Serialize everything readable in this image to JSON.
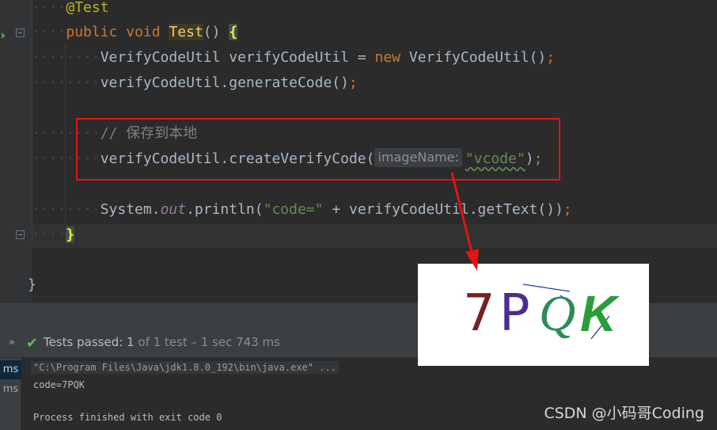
{
  "editor": {
    "lines": {
      "annotation": "@Test",
      "kw_public": "public",
      "kw_void": "void",
      "method_name": "Test",
      "parens_open": "() ",
      "brace_open": "{",
      "l1_type": "VerifyCodeUtil",
      "l1_var": " verifyCodeUtil = ",
      "kw_new": "new",
      "l1_ctor": " VerifyCodeUtil()",
      "semi": ";",
      "l2_code": "verifyCodeUtil.generateCode()",
      "comment": "// 保存到本地",
      "l4_call": "verifyCodeUtil.createVerifyCode(",
      "l4_hint": "imageName:",
      "l4_arg": "\"vcode\"",
      "l4_close": ")",
      "l5_sys": "System.",
      "l5_out": "out",
      "l5_print": ".println(",
      "l5_str": "\"code=\"",
      "l5_rest": " + verifyCodeUtil.getText())",
      "brace_close_method": "}",
      "brace_close_class": "}"
    }
  },
  "run_panel": {
    "status_prefix": "Tests passed:",
    "status_count": "1",
    "status_suffix": "of 1 test – 1 sec 743 ms",
    "left_items": [
      "ms",
      "ms"
    ],
    "console": {
      "cmd": "\"C:\\Program Files\\Java\\jdk1.8.0_192\\bin\\java.exe\" ...",
      "output": "code=7PQK",
      "exit": "Process finished with exit code 0"
    }
  },
  "captcha": {
    "chars": [
      "7",
      "P",
      "Q",
      "K"
    ],
    "colors": [
      "#7a1f1f",
      "#4c2d8f",
      "#2e8b57",
      "#2a9d3a"
    ]
  },
  "watermark": "CSDN @小码哥Coding",
  "colors": {
    "keyword": "#cc7832",
    "string": "#6a8759",
    "method": "#ffc66d",
    "highlight_box": "#e31414",
    "pass_check": "#5fb85a"
  }
}
